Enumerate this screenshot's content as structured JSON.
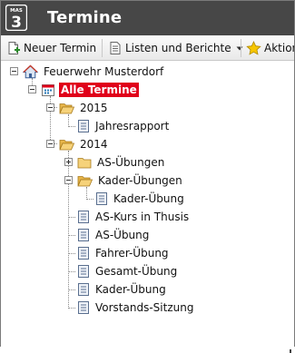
{
  "app": {
    "badge_top": "MAS",
    "badge_number": "3",
    "title": "Termine"
  },
  "toolbar": {
    "new_label": "Neuer Termin",
    "lists_label": "Listen und Berichte",
    "actions_label": "Aktion"
  },
  "tree": {
    "root": "Feuerwehr Musterdorf",
    "all": "Alle Termine",
    "year_2015": "2015",
    "jahresrapport": "Jahresrapport",
    "year_2014": "2014",
    "as_uebungen": "AS-Übungen",
    "kader_uebungen": "Kader-Übungen",
    "kader_uebung_child": "Kader-Übung",
    "as_kurs": "AS-Kurs in Thusis",
    "as_uebung": "AS-Übung",
    "fahrer_uebung": "Fahrer-Übung",
    "gesamt_uebung": "Gesamt-Übung",
    "kader_uebung": "Kader-Übung",
    "vorstands_sitzung": "Vorstands-Sitzung"
  },
  "colors": {
    "titlebar": "#474747",
    "selected": "#e0001a"
  }
}
